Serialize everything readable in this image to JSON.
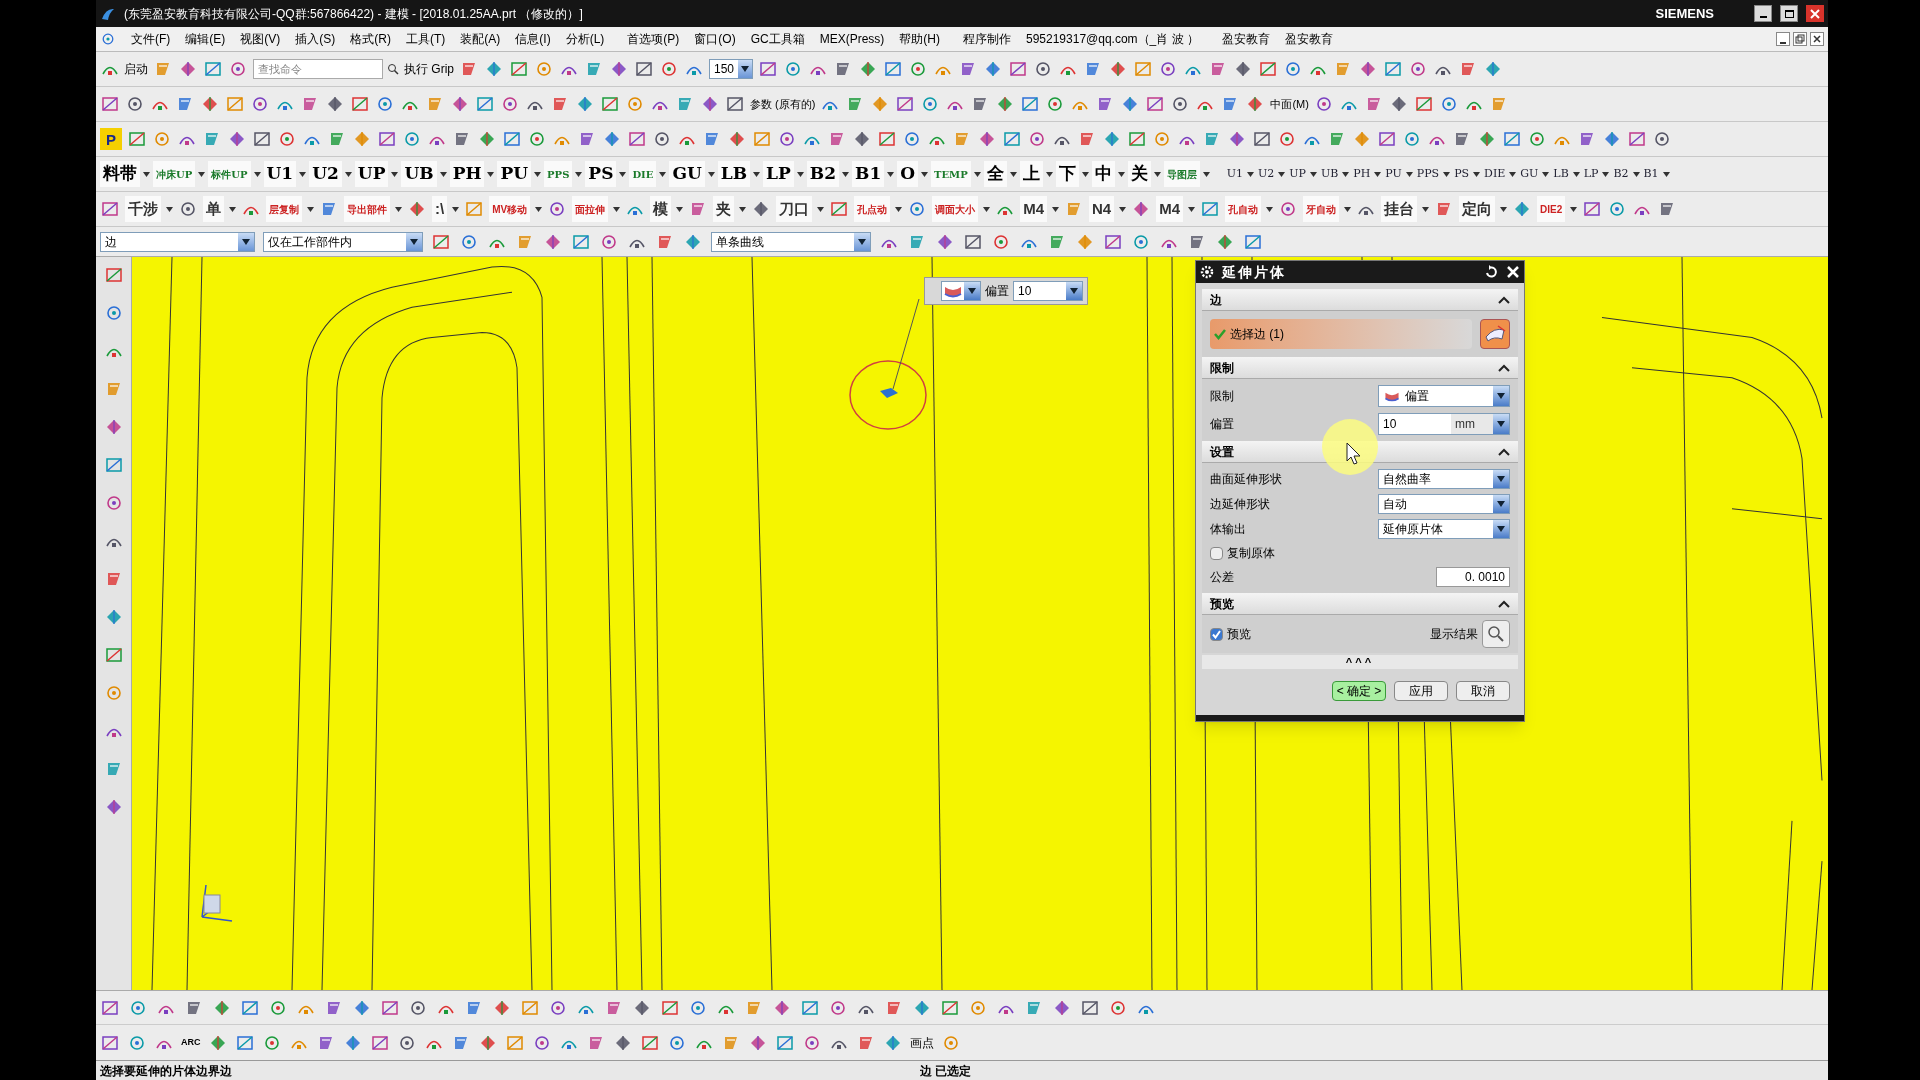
{
  "window": {
    "title": "(东莞盈安教育科技有限公司-QQ群:567866422) - 建模 - [2018.01.25AA.prt （修改的）]",
    "brand": "SIEMENS"
  },
  "menu": [
    "文件(F)",
    "编辑(E)",
    "视图(V)",
    "插入(S)",
    "格式(R)",
    "工具(T)",
    "装配(A)",
    "信息(I)",
    "分析(L)",
    "首选项(P)",
    "窗口(O)",
    "GC工具箱",
    "MEX(Press)",
    "帮助(H)",
    "程序制作",
    "595219317@qq.com（_肖 波 ）",
    "盈安教育",
    "盈安教育"
  ],
  "toolbar_1": {
    "start_label": "启动",
    "search_placeholder": "查找命令",
    "grip_label": "执行 Grip",
    "zoom_value": "150"
  },
  "toolbar_2": {
    "params_label": "参数 (原有的)",
    "midface_label": "中面(M)"
  },
  "toolbar_3": {
    "p_label": "P"
  },
  "toolbar_4": {
    "left": [
      "料带",
      "冲床UP",
      "标件UP",
      "U1",
      "U2",
      "UP",
      "UB",
      "PH",
      "PU",
      "PPS",
      "PS",
      "DIE",
      "GU",
      "LB",
      "LP",
      "B2",
      "B1",
      "O",
      "TEMP",
      "全",
      "上",
      "下",
      "中",
      "关",
      "导图层"
    ],
    "right": [
      "U1",
      "U2",
      "UP",
      "UB",
      "PH",
      "PU",
      "PPS",
      "PS",
      "DIE",
      "GU",
      "LB",
      "LP",
      "B2",
      "B1"
    ]
  },
  "toolbar_5": [
    "千涉",
    "单",
    "层复制",
    "导出部件",
    ":\\",
    "MV移动",
    "面拉伸",
    "模",
    "夹",
    "刀口",
    "孔点动",
    "调面大小",
    "M4",
    "N4",
    "M4",
    "孔自动",
    "牙自动",
    "挂台",
    "定向",
    "DIE2"
  ],
  "selection_bar": {
    "type_filter": "边",
    "scope_filter": "仅在工作部件内",
    "curve_rule": "单条曲线"
  },
  "floating_toolbar": {
    "label": "偏置",
    "value": "10"
  },
  "dialog": {
    "title": "延伸片体",
    "edge_section": {
      "title": "边",
      "select_label": "选择边 (1)"
    },
    "limit_section": {
      "title": "限制",
      "limit_label": "限制",
      "limit_value": "偏置",
      "offset_label": "偏置",
      "offset_value": "10",
      "offset_unit": "mm"
    },
    "settings_section": {
      "title": "设置",
      "rows": [
        {
          "label": "曲面延伸形状",
          "value": "自然曲率"
        },
        {
          "label": "边延伸形状",
          "value": "自动"
        },
        {
          "label": "体输出",
          "value": "延伸原片体"
        }
      ],
      "copy_label": "复制原体",
      "copy_checked": false,
      "tolerance_label": "公差",
      "tolerance_value": "0. 0010"
    },
    "preview_section": {
      "title": "预览",
      "preview_label": "预览",
      "preview_checked": true,
      "show_result_label": "显示结果"
    },
    "more_label": "^^^",
    "buttons": [
      {
        "label": "< 确定 >",
        "default": true
      },
      {
        "label": "应用",
        "default": false
      },
      {
        "label": "取消",
        "default": false
      }
    ]
  },
  "bottom_toolbar": {
    "arc_label": "ARC",
    "point_label": "画点"
  },
  "status_bar": {
    "prompt": "选择要延伸的片体边界边",
    "status": "边 已选定"
  }
}
